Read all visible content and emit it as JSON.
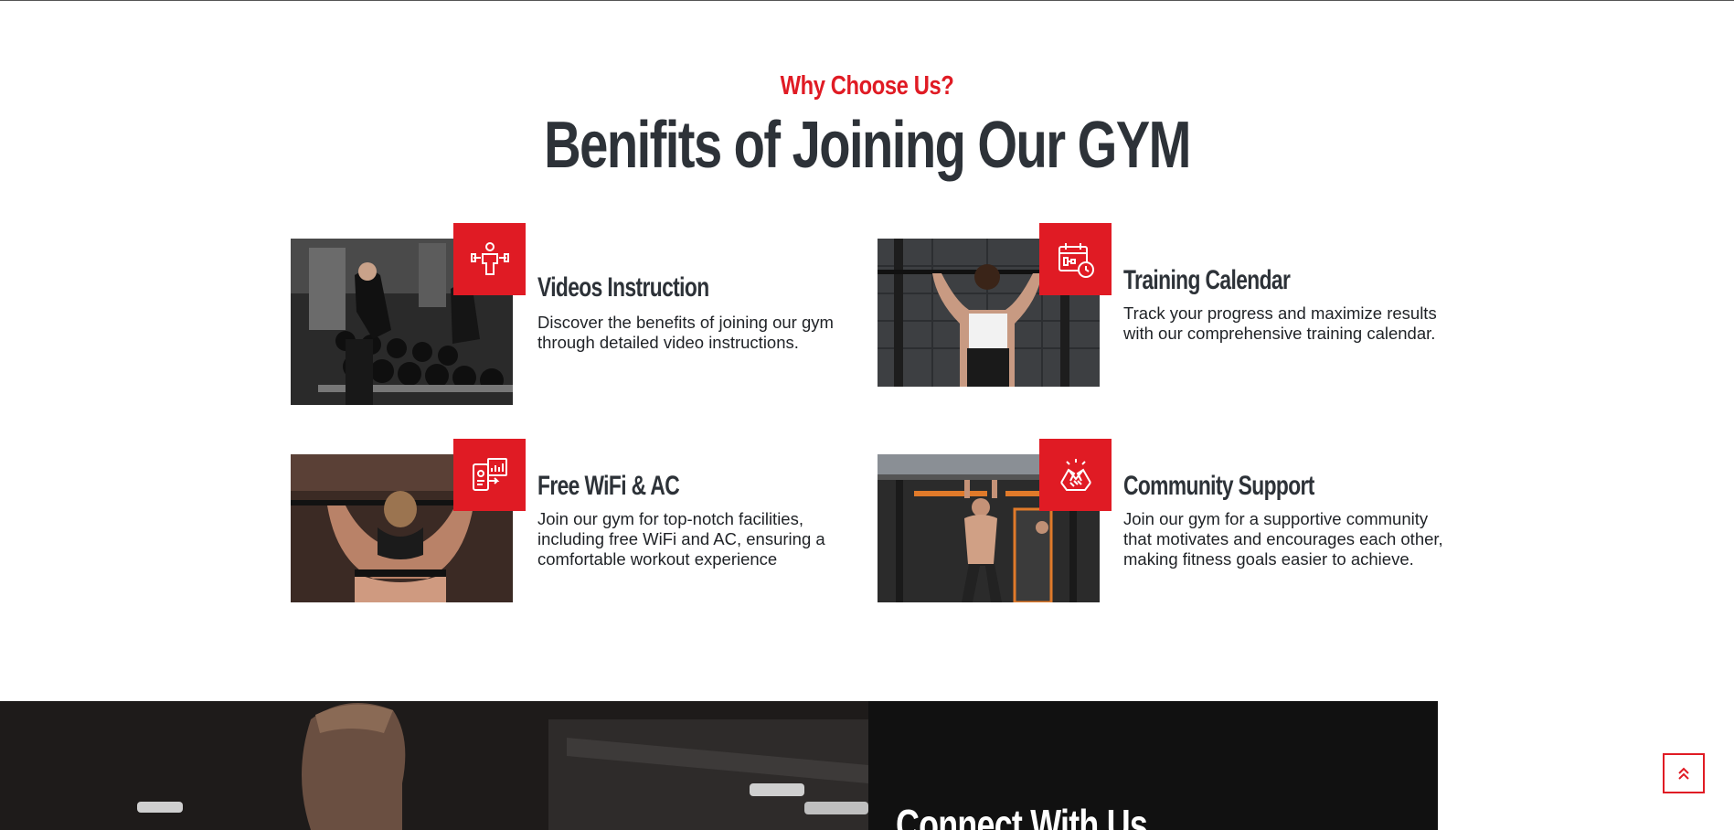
{
  "section": {
    "eyebrow": "Why Choose Us?",
    "title": "Benifits of Joining Our GYM"
  },
  "benefits": [
    {
      "title": "Videos Instruction",
      "text": "Discover the benefits of joining our gym through detailed video instructions.",
      "icon": "trainer-icon"
    },
    {
      "title": "Training Calendar",
      "text": "Track your progress and maximize results with our comprehensive training calendar.",
      "icon": "calendar-clock-icon"
    },
    {
      "title": "Free WiFi & AC",
      "text": "Join our gym for top-notch facilities, including free WiFi and AC, ensuring a comfortable workout experience",
      "icon": "tablet-stats-icon"
    },
    {
      "title": "Community Support",
      "text": "Join our gym for a supportive community that motivates and encourages each other, making fitness goals easier to achieve.",
      "icon": "handshake-icon"
    }
  ],
  "connect": {
    "title": "Connect With Us"
  },
  "scroll_top": {
    "icon": "double-chevron-up-icon"
  },
  "colors": {
    "accent": "#e01b24",
    "heading": "#2d3238",
    "dark_panel": "#111111"
  }
}
